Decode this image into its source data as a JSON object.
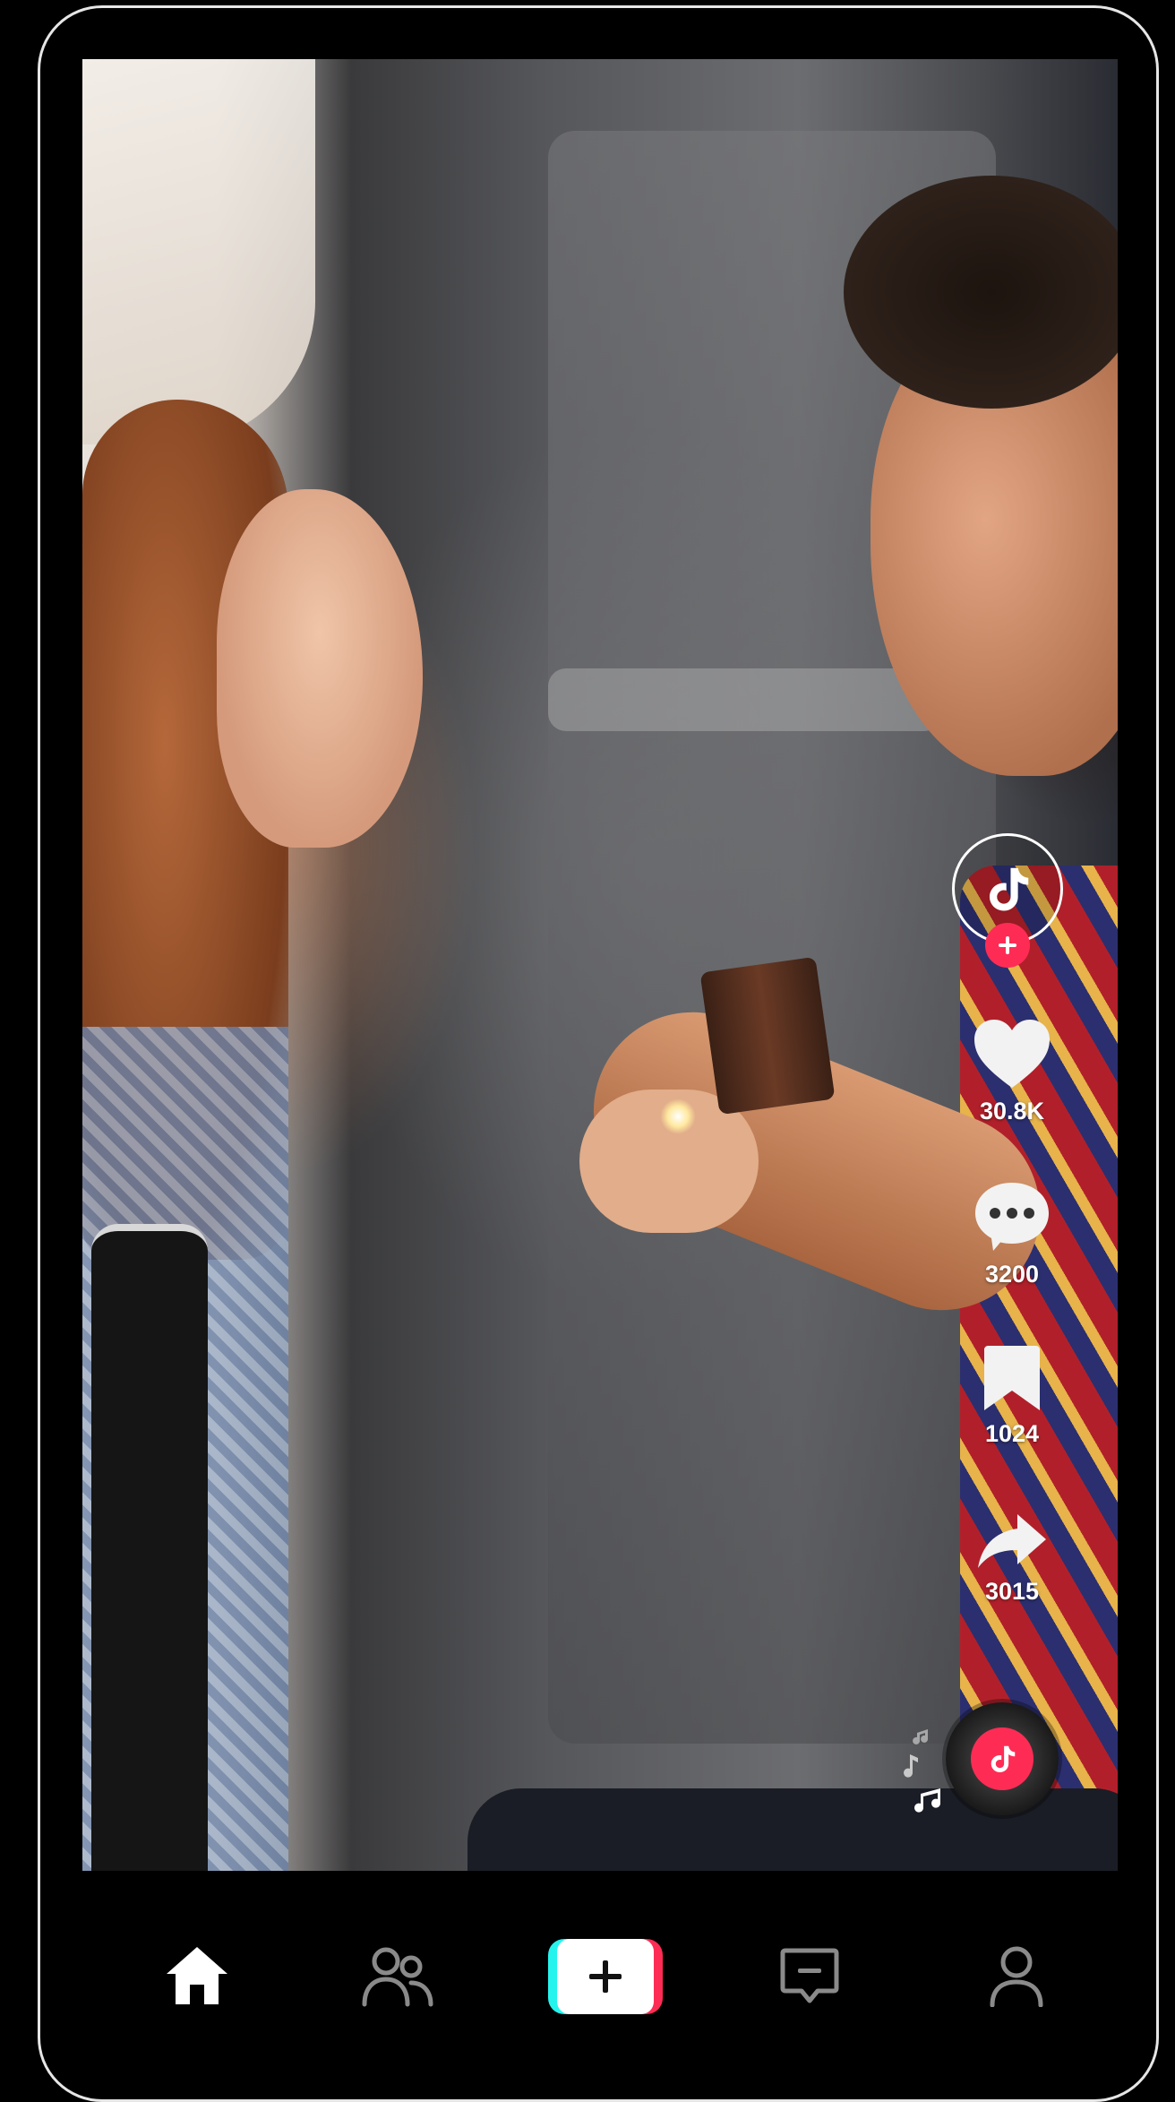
{
  "app": {
    "name": "TikTok"
  },
  "video": {
    "description_icons": [
      "video-frame"
    ]
  },
  "side_rail": {
    "creator_avatar_icon": "tiktok-logo-icon",
    "follow_icon": "plus-icon",
    "like": {
      "icon": "heart-icon",
      "count": "30.8K"
    },
    "comment": {
      "icon": "comment-bubble-icon",
      "count": "3200"
    },
    "bookmark": {
      "icon": "bookmark-icon",
      "count": "1024"
    },
    "share": {
      "icon": "share-arrow-icon",
      "count": "3015"
    },
    "music_disc_icon": "tiktok-logo-icon"
  },
  "bottom_nav": {
    "items": [
      {
        "icon": "home-icon",
        "active": true
      },
      {
        "icon": "friends-icon",
        "active": false
      },
      {
        "icon": "create-plus-icon",
        "active": false
      },
      {
        "icon": "inbox-icon",
        "active": false
      },
      {
        "icon": "profile-icon",
        "active": false
      }
    ]
  },
  "colors": {
    "accent_pink": "#fe2c55",
    "accent_cyan": "#25f4ee",
    "background": "#000000",
    "inactive_icon": "#8a8a8a"
  }
}
